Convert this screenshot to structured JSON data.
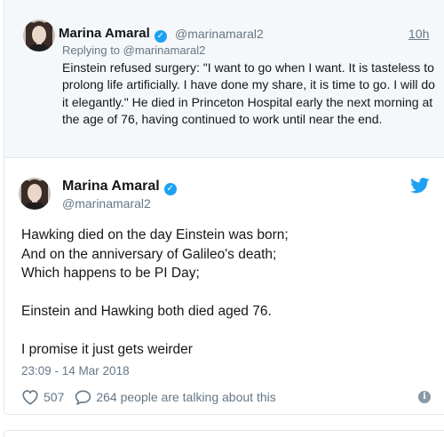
{
  "parent_tweet": {
    "name": "Marina Amaral",
    "handle": "@marinamaral2",
    "time": "10h",
    "replying_to_prefix": "Replying to",
    "replying_to_handle": "@marinamaral2",
    "text": "Einstein refused surgery: \"I want to go when I want. It is tasteless to prolong life artificially. I have done my share, it is time to go. I will do it elegantly.\" He died in Princeton Hospital early the next morning at the age of 76, having continued to work until near the end."
  },
  "main_tweet": {
    "name": "Marina Amaral",
    "handle": "@marinamaral2",
    "text": "Hawking died on the day Einstein was born;\nAnd on the anniversary of Galileo's death;\nWhich happens to be PI Day;\n\nEinstein and Hawking both died aged 76.\n\nI promise it just gets weirder",
    "timestamp": "23:09 - 14 Mar 2018",
    "likes": "507",
    "conversation": "264 people are talking about this"
  },
  "icons": {
    "verified": "verified-badge-icon",
    "bird": "twitter-bird-icon",
    "heart": "heart-icon",
    "reply": "speech-bubble-icon",
    "info": "info-icon"
  },
  "colors": {
    "brand": "#1da1f2",
    "muted": "#657786",
    "text": "#14171a",
    "parent_bg": "#f5f8fa"
  }
}
